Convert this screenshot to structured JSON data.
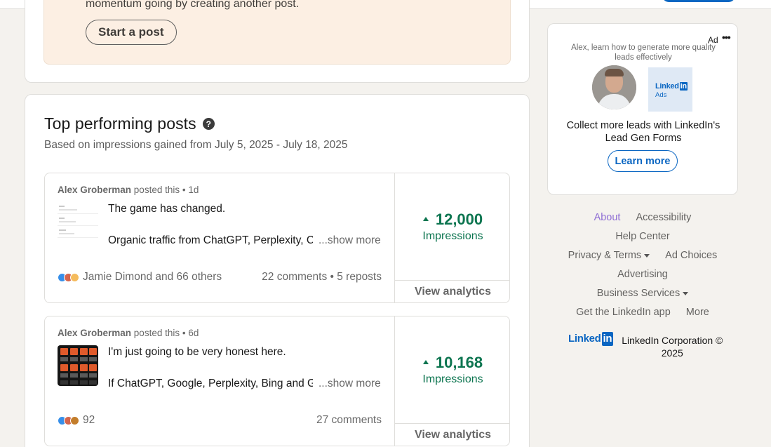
{
  "promo": {
    "text": "momentum going by creating another post.",
    "button": "Start a post"
  },
  "top_posts": {
    "title": "Top performing posts",
    "subtitle": "Based on impressions gained from July 5, 2025 - July 18, 2025",
    "posts": [
      {
        "author": "Alex Groberman",
        "meta": " posted this • 1d",
        "line1": "The game has changed.",
        "line2": "Organic traffic from ChatGPT, Perplexity, Claude",
        "show_more": "...show more",
        "reactions": "Jamie Dimond and 66 others",
        "engagement": "22 comments • 5 reposts",
        "impressions": "12,000",
        "impressions_label": "Impressions",
        "analytics": "View analytics"
      },
      {
        "author": "Alex Groberman",
        "meta": " posted this • 6d",
        "line1": "I'm just going to be very honest here.",
        "line2": "If ChatGPT, Google, Perplexity, Bing and Gemini",
        "show_more": "...show more",
        "reactions": "92",
        "engagement": "27 comments",
        "impressions": "10,168",
        "impressions_label": "Impressions",
        "analytics": "View analytics"
      }
    ]
  },
  "ad": {
    "label": "Ad",
    "more": "•••",
    "tagline": "Alex, learn how to generate more quality leads effectively",
    "logo_word": "Linked",
    "logo_in": "in",
    "logo_sub": "Ads",
    "headline": "Collect more leads with LinkedIn's Lead Gen Forms",
    "cta": "Learn more"
  },
  "footer": {
    "about": "About",
    "accessibility": "Accessibility",
    "help_center": "Help Center",
    "privacy_terms": "Privacy & Terms",
    "ad_choices": "Ad Choices",
    "advertising": "Advertising",
    "business_services": "Business Services",
    "get_app": "Get the LinkedIn app",
    "more": "More",
    "logo_word": "Linked",
    "logo_in": "in",
    "copyright": "LinkedIn Corporation © 2025"
  },
  "colors": {
    "accent": "#0a66c2",
    "positive": "#0d7550",
    "promo_bg": "#fcefe3",
    "page_bg": "#f4f2ee"
  }
}
